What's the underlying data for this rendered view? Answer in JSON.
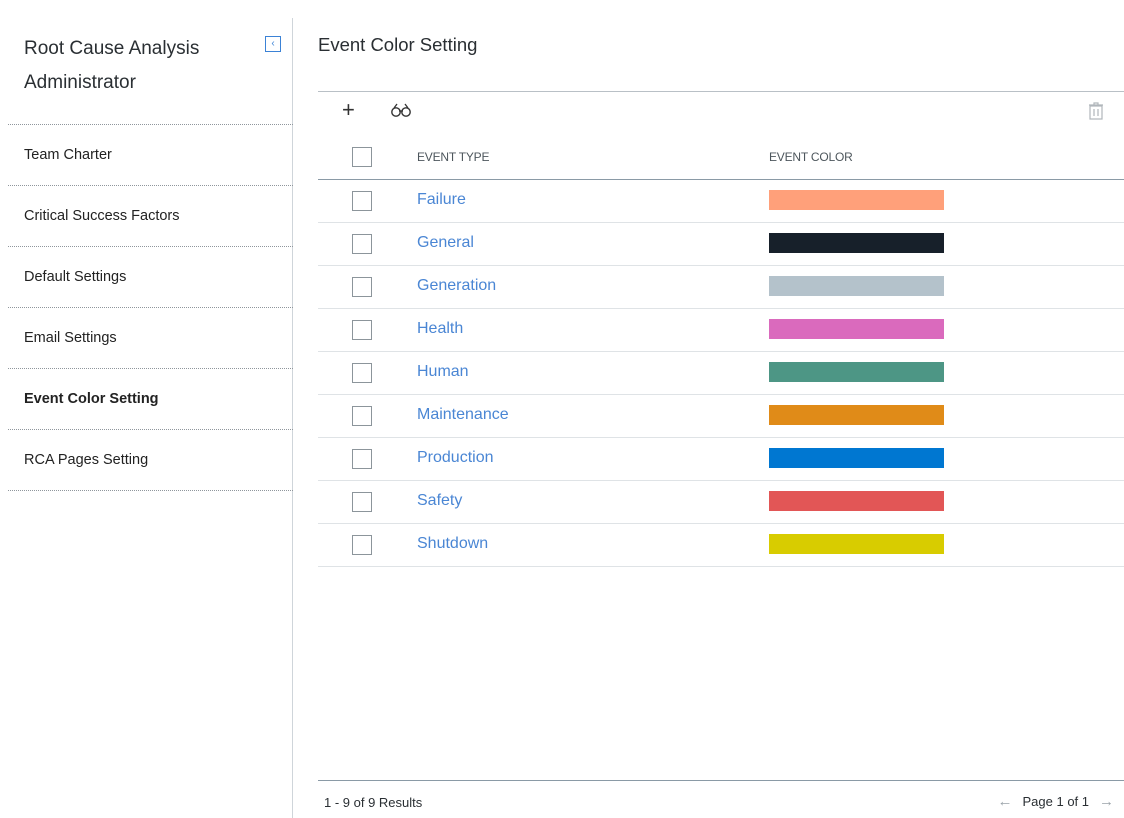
{
  "sidebar": {
    "title": "Root Cause Analysis Administrator",
    "collapse_glyph": "‹",
    "items": [
      {
        "label": "Team Charter"
      },
      {
        "label": "Critical Success Factors"
      },
      {
        "label": "Default Settings"
      },
      {
        "label": "Email Settings"
      },
      {
        "label": "Event Color Setting",
        "active": true
      },
      {
        "label": "RCA Pages Setting"
      }
    ]
  },
  "main": {
    "title": "Event Color Setting",
    "add_glyph": "+",
    "columns": {
      "event_type": "EVENT TYPE",
      "event_color": "EVENT COLOR"
    },
    "rows": [
      {
        "event_type": "Failure",
        "color": "#FFA07A"
      },
      {
        "event_type": "General",
        "color": "#17202A"
      },
      {
        "event_type": "Generation",
        "color": "#B4C2CB"
      },
      {
        "event_type": "Health",
        "color": "#DA6ABD"
      },
      {
        "event_type": "Human",
        "color": "#4D9685"
      },
      {
        "event_type": "Maintenance",
        "color": "#E08B18"
      },
      {
        "event_type": "Production",
        "color": "#0077D1"
      },
      {
        "event_type": "Safety",
        "color": "#E25656"
      },
      {
        "event_type": "Shutdown",
        "color": "#D8CC00"
      }
    ],
    "footer": {
      "results": "1 - 9 of 9 Results",
      "page": "Page 1 of 1",
      "prev_glyph": "←",
      "next_glyph": "→"
    }
  }
}
